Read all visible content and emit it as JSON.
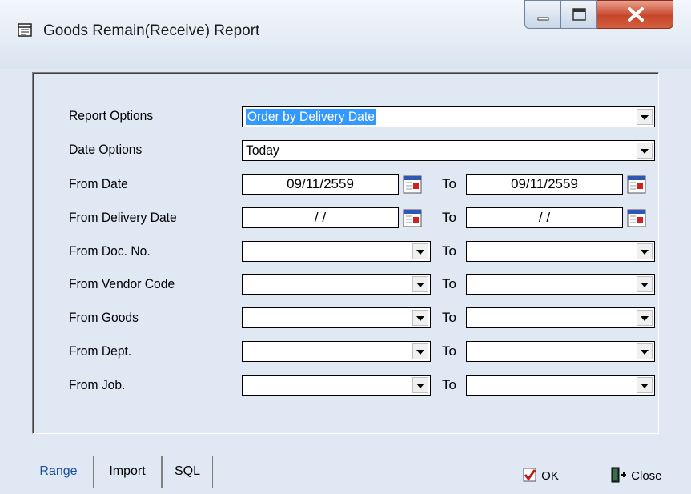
{
  "window": {
    "title": "Goods Remain(Receive) Report"
  },
  "form": {
    "rows": [
      {
        "label": "Report Options"
      },
      {
        "label": "Date Options"
      },
      {
        "label": "From Date"
      },
      {
        "label": "From Delivery Date"
      },
      {
        "label": "From Doc. No."
      },
      {
        "label": "From Vendor Code"
      },
      {
        "label": "From Goods"
      },
      {
        "label": "From Dept."
      },
      {
        "label": "From Job."
      }
    ],
    "report_option_value": "Order by Delivery Date",
    "date_option_value": "Today",
    "from_date": "09/11/2559",
    "to_date": "09/11/2559",
    "from_delivery_date": "/  /",
    "to_delivery_date": "/  /",
    "to_label": "To"
  },
  "tabs": [
    "Range",
    "Import",
    "SQL"
  ],
  "footer": {
    "ok_label": "OK",
    "close_label": "Close"
  },
  "colors": {
    "selection": "#3399ff",
    "active_tab": "#1a4fa5"
  }
}
